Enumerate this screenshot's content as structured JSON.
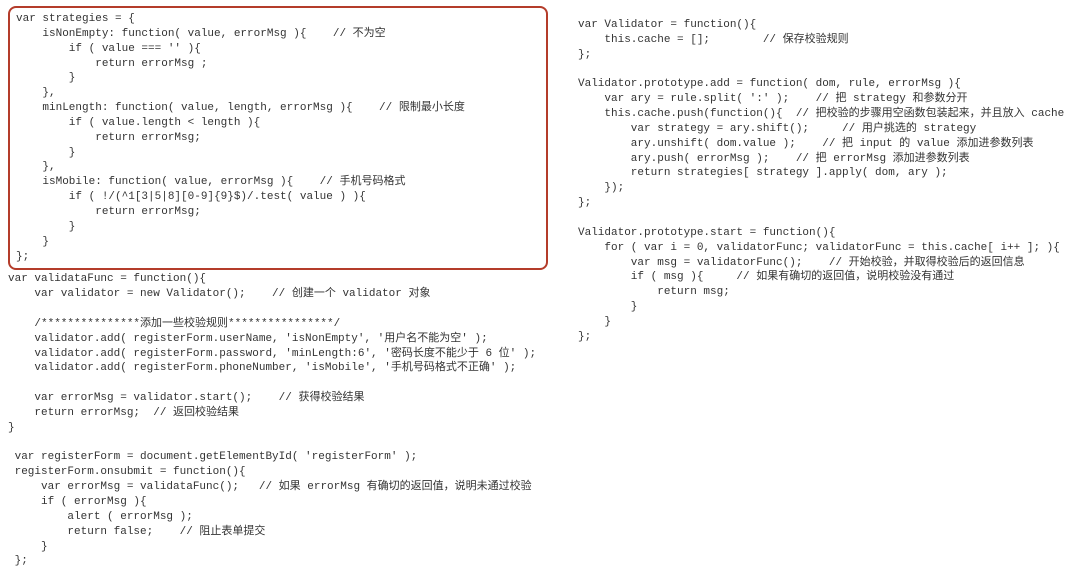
{
  "left": {
    "boxed": "var strategies = {\n    isNonEmpty: function( value, errorMsg ){    // 不为空\n        if ( value === '' ){\n            return errorMsg ;\n        }\n    },\n    minLength: function( value, length, errorMsg ){    // 限制最小长度\n        if ( value.length < length ){\n            return errorMsg;\n        }\n    },\n    isMobile: function( value, errorMsg ){    // 手机号码格式\n        if ( !/(^1[3|5|8][0-9]{9}$)/.test( value ) ){\n            return errorMsg;\n        }\n    }\n};",
    "rest": "var validataFunc = function(){\n    var validator = new Validator();    // 创建一个 validator 对象\n\n    /***************添加一些校验规则****************/\n    validator.add( registerForm.userName, 'isNonEmpty', '用户名不能为空' );\n    validator.add( registerForm.password, 'minLength:6', '密码长度不能少于 6 位' );\n    validator.add( registerForm.phoneNumber, 'isMobile', '手机号码格式不正确' );\n\n    var errorMsg = validator.start();    // 获得校验结果\n    return errorMsg;  // 返回校验结果\n}\n\n var registerForm = document.getElementById( 'registerForm' );\n registerForm.onsubmit = function(){\n     var errorMsg = validataFunc();   // 如果 errorMsg 有确切的返回值，说明未通过校验\n     if ( errorMsg ){\n         alert ( errorMsg );\n         return false;    // 阻止表单提交\n     }\n };"
  },
  "right": {
    "code": "var Validator = function(){\n    this.cache = [];        // 保存校验规则\n};\n\nValidator.prototype.add = function( dom, rule, errorMsg ){\n    var ary = rule.split( ':' );    // 把 strategy 和参数分开\n    this.cache.push(function(){  // 把校验的步骤用空函数包装起来，并且放入 cache\n        var strategy = ary.shift();     // 用户挑选的 strategy\n        ary.unshift( dom.value );    // 把 input 的 value 添加进参数列表\n        ary.push( errorMsg );    // 把 errorMsg 添加进参数列表\n        return strategies[ strategy ].apply( dom, ary );\n    });\n};\n\nValidator.prototype.start = function(){\n    for ( var i = 0, validatorFunc; validatorFunc = this.cache[ i++ ]; ){\n        var msg = validatorFunc();    // 开始校验，并取得校验后的返回信息\n        if ( msg ){     // 如果有确切的返回值，说明校验没有通过\n            return msg;\n        }\n    }\n};"
  }
}
